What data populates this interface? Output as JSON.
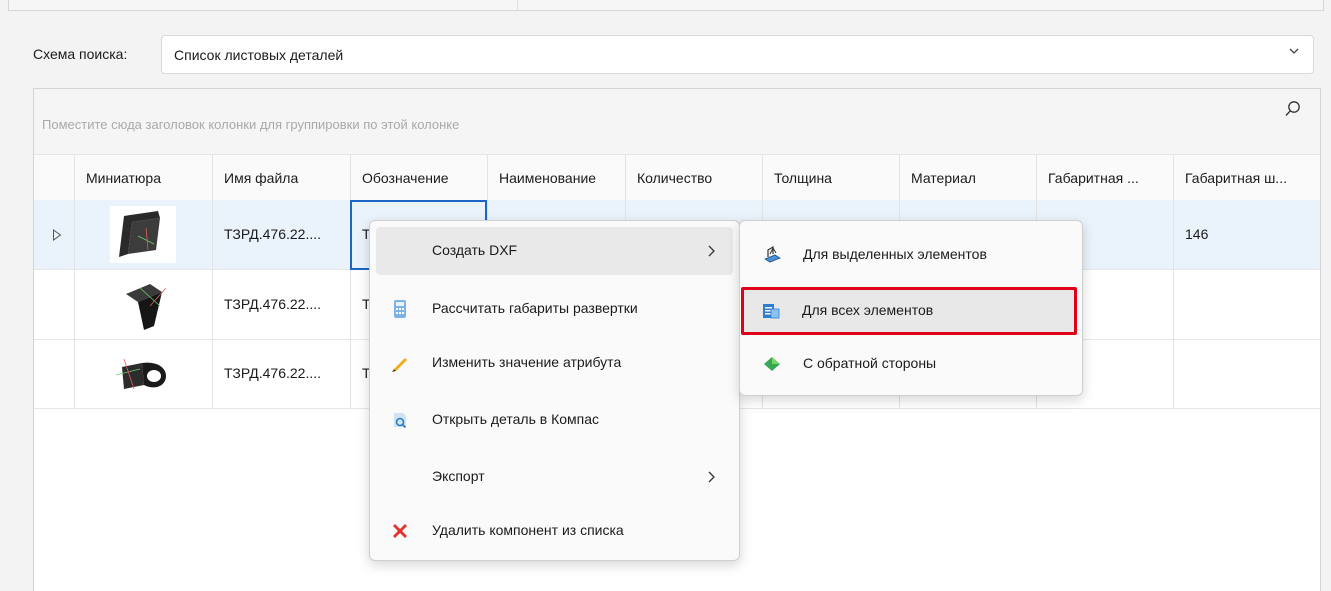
{
  "search": {
    "label": "Схема поиска:",
    "selected": "Список листовых деталей"
  },
  "grid": {
    "group_hint": "Поместите сюда заголовок колонки для группировки по этой колонке",
    "columns": [
      "Миниатюра",
      "Имя файла",
      "Обозначение",
      "Наименование",
      "Количество",
      "Толщина",
      "Материал",
      "Габаритная ...",
      "Габаритная ш..."
    ],
    "rows": [
      {
        "file": "ТЗРД.476.22....",
        "designation": "Т",
        "width": "146"
      },
      {
        "file": "ТЗРД.476.22....",
        "designation": "Т",
        "width": ""
      },
      {
        "file": "ТЗРД.476.22....",
        "designation": "Т",
        "width": ""
      }
    ]
  },
  "context_menu": {
    "items": [
      {
        "label": "Создать DXF",
        "icon": "none",
        "submenu": true
      },
      {
        "label": "Рассчитать габариты развертки",
        "icon": "calculator-icon",
        "submenu": false
      },
      {
        "label": "Изменить значение атрибута",
        "icon": "pencil-icon",
        "submenu": false
      },
      {
        "label": "Открыть деталь в Компас",
        "icon": "open-part-icon",
        "submenu": false
      },
      {
        "label": "Экспорт",
        "icon": "none",
        "submenu": true
      },
      {
        "label": "Удалить компонент из списка",
        "icon": "delete-x-icon",
        "submenu": false
      }
    ]
  },
  "dxf_submenu": {
    "items": [
      {
        "label": "Для выделенных элементов",
        "icon": "selected-elements-icon"
      },
      {
        "label": "Для всех элементов",
        "icon": "all-elements-icon"
      },
      {
        "label": "С обратной стороны",
        "icon": "reverse-side-icon"
      }
    ]
  },
  "colors": {
    "highlight_border": "#e00018",
    "selected_row": "#eaf2fb",
    "focus_cell": "#1e66c4"
  }
}
